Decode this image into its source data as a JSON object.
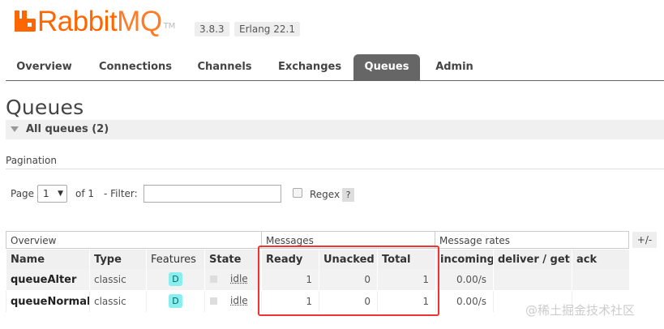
{
  "header": {
    "logo_text_rabbit": "Rabbit",
    "logo_text_mq": "MQ",
    "logo_tm": "TM",
    "version": "3.8.3",
    "erlang": "Erlang 22.1"
  },
  "tabs": [
    {
      "label": "Overview"
    },
    {
      "label": "Connections"
    },
    {
      "label": "Channels"
    },
    {
      "label": "Exchanges"
    },
    {
      "label": "Queues",
      "active": true
    },
    {
      "label": "Admin"
    }
  ],
  "page_title": "Queues",
  "section": {
    "label": "All queues (2)"
  },
  "pagination": {
    "label": "Pagination",
    "page_label": "Page",
    "page_value": "1",
    "of_label": "of 1",
    "filter_label": "- Filter:",
    "filter_value": "",
    "regex_label": "Regex",
    "help_label": "?"
  },
  "table": {
    "groups": {
      "overview": "Overview",
      "messages": "Messages",
      "message_rates": "Message rates"
    },
    "toggle_columns": "+/-",
    "columns": {
      "name": "Name",
      "type": "Type",
      "features": "Features",
      "state": "State",
      "ready": "Ready",
      "unacked": "Unacked",
      "total": "Total",
      "incoming": "incoming",
      "deliver_get": "deliver / get",
      "ack": "ack"
    },
    "rows": [
      {
        "name": "queueAlter",
        "type": "classic",
        "feature": "D",
        "state": "idle",
        "ready": "1",
        "unacked": "0",
        "total": "1",
        "incoming": "0.00/s",
        "deliver_get": "",
        "ack": ""
      },
      {
        "name": "queueNormal",
        "type": "classic",
        "feature": "D",
        "state": "idle",
        "ready": "1",
        "unacked": "0",
        "total": "1",
        "incoming": "0.00/s",
        "deliver_get": "",
        "ack": ""
      }
    ]
  },
  "watermark": "@稀土掘金技术社区",
  "colors": {
    "brand": "#ff6600",
    "active_tab": "#666666",
    "highlight": "#ee3333",
    "feature_badge": "#88eeee"
  }
}
